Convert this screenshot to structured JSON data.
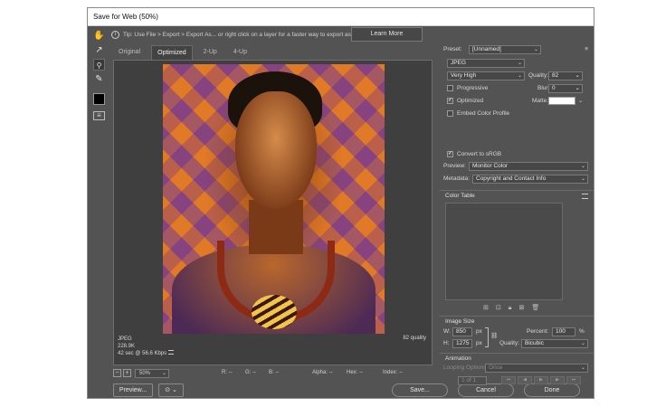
{
  "window": {
    "title": "Save for Web (50%)"
  },
  "tools": [
    {
      "name": "hand-tool-icon",
      "glyph": "✋"
    },
    {
      "name": "slice-select-tool-icon",
      "glyph": "↗"
    },
    {
      "name": "zoom-tool-icon",
      "glyph": "🔍"
    },
    {
      "name": "eyedropper-tool-icon",
      "glyph": "✎"
    }
  ],
  "tip": {
    "text": "Tip: Use File > Export > Export As... or right click on a layer for a faster way to export assets",
    "button": "Learn More"
  },
  "tabs": [
    "Original",
    "Optimized",
    "2-Up",
    "4-Up"
  ],
  "preview_info": {
    "format": "JPEG",
    "size": "228.9K",
    "time": "42 sec @ 56.6 Kbps",
    "quality": "82 quality"
  },
  "status": {
    "zoom": "50%",
    "r": "R: --",
    "g": "G: --",
    "b": "B: --",
    "alpha": "Alpha: --",
    "hex": "Hex: --",
    "index": "Index: --"
  },
  "buttons": {
    "preview": "Preview...",
    "save": "Save...",
    "cancel": "Cancel",
    "done": "Done"
  },
  "settings": {
    "preset_label": "Preset:",
    "preset_value": "[Unnamed]",
    "format": "JPEG",
    "quality_preset": "Very High",
    "quality_label": "Quality:",
    "quality_value": "82",
    "progressive": "Progressive",
    "blur_label": "Blur:",
    "blur_value": "0",
    "optimized": "Optimized",
    "matte_label": "Matte:",
    "embed_profile": "Embed Color Profile",
    "convert_srgb": "Convert to sRGB",
    "preview_label": "Preview:",
    "preview_value": "Monitor Color",
    "metadata_label": "Metadata:",
    "metadata_value": "Copyright and Contact Info"
  },
  "color_table": {
    "title": "Color Table"
  },
  "image_size": {
    "title": "Image Size",
    "w_label": "W:",
    "w_value": "850",
    "h_label": "H:",
    "h_value": "1275",
    "unit": "px",
    "percent_label": "Percent:",
    "percent_value": "100",
    "percent_unit": "%",
    "quality_label": "Quality:",
    "quality_value": "Bicubic"
  },
  "animation": {
    "title": "Animation",
    "looping_label": "Looping Options:",
    "looping_value": "Once",
    "frame": "1 of 1"
  }
}
